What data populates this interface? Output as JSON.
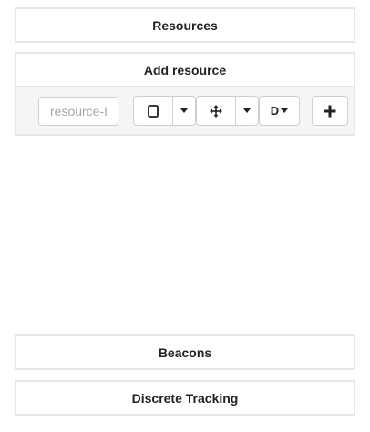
{
  "panels": {
    "resources": "Resources",
    "add_resource": "Add resource",
    "beacons": "Beacons",
    "discrete_tracking": "Discrete Tracking"
  },
  "toolbar": {
    "id_input": {
      "placeholder": "resource-ID",
      "value": ""
    },
    "shape_button_icon": "square-outline-icon",
    "move_button_icon": "move-arrows-icon",
    "d_button_label": "D",
    "add_button_icon": "plus-icon"
  }
}
